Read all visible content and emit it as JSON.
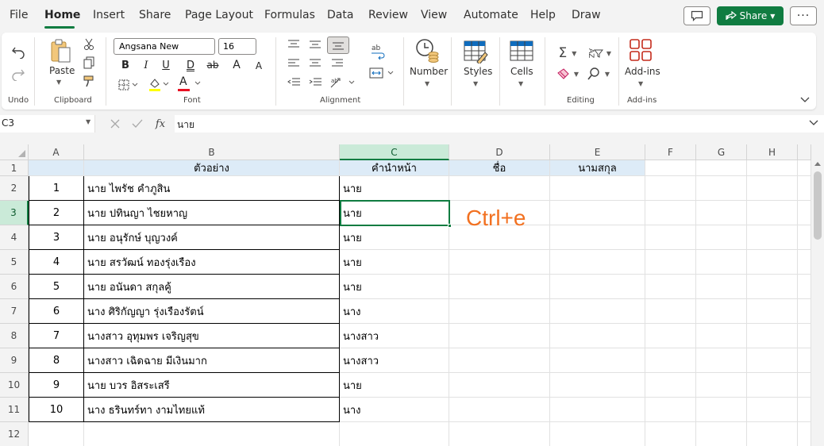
{
  "menu": {
    "tabs": [
      "File",
      "Home",
      "Insert",
      "Share",
      "Page Layout",
      "Formulas",
      "Data",
      "Review",
      "View",
      "Automate",
      "Help",
      "Draw"
    ],
    "active_tab": "Home",
    "share_label": "Share",
    "more_label": "···"
  },
  "ribbon": {
    "groups": {
      "undo": "Undo",
      "clipboard": "Clipboard",
      "font": "Font",
      "alignment": "Alignment",
      "editing": "Editing",
      "addins": "Add-ins"
    },
    "paste_label": "Paste",
    "font_name": "Angsana New",
    "font_size": "16",
    "number_label": "Number",
    "styles_label": "Styles",
    "cells_label": "Cells",
    "addins_label": "Add-ins",
    "bold": "B",
    "italic": "I",
    "underline": "U",
    "double_underline": "D",
    "strikethrough": "ab",
    "grow_font": "A",
    "shrink_font": "A",
    "font_color_letter": "A",
    "sum_symbol": "Σ",
    "sort_label": "AZ"
  },
  "formula_bar": {
    "name_box": "C3",
    "fx": "fx",
    "value": "นาย"
  },
  "columns": [
    "A",
    "B",
    "C",
    "D",
    "E",
    "F",
    "G",
    "H"
  ],
  "rows": [
    "1",
    "2",
    "3",
    "4",
    "5",
    "6",
    "7",
    "8",
    "9",
    "10",
    "11",
    "12"
  ],
  "header_row": {
    "A": "",
    "B": "ตัวอย่าง",
    "C": "คำนำหน้า",
    "D": "ชื่อ",
    "E": "นามสกุล"
  },
  "data_rows": [
    {
      "num": "1",
      "sample": "นาย ไพรัช คำภูสิน",
      "prefix": "นาย"
    },
    {
      "num": "2",
      "sample": "นาย ปทินญา ไชยหาญ",
      "prefix": "นาย"
    },
    {
      "num": "3",
      "sample": "นาย อนุรักษ์ บุญวงค์",
      "prefix": "นาย"
    },
    {
      "num": "4",
      "sample": "นาย สรวัฒน์ ทองรุ่งเรือง",
      "prefix": "นาย"
    },
    {
      "num": "5",
      "sample": "นาย อนันดา สกุลคู้",
      "prefix": "นาย"
    },
    {
      "num": "6",
      "sample": "นาง ศิริกัญญา รุ่งเรืองรัตน์",
      "prefix": "นาง"
    },
    {
      "num": "7",
      "sample": "นางสาว อุทุมพร เจริญสุข",
      "prefix": "นางสาว"
    },
    {
      "num": "8",
      "sample": "นางสาว เฉิดฉาย มีเงินมาก",
      "prefix": "นางสาว"
    },
    {
      "num": "9",
      "sample": "นาย บวร อิสระเสรี",
      "prefix": "นาย"
    },
    {
      "num": "10",
      "sample": "นาง ธรินทร์ทา งามไทยแท้",
      "prefix": "นาง"
    }
  ],
  "annotation": "Ctrl+e",
  "colors": {
    "accent": "#107c41",
    "header_fill": "#ddebf7",
    "annotation": "#f27121"
  }
}
